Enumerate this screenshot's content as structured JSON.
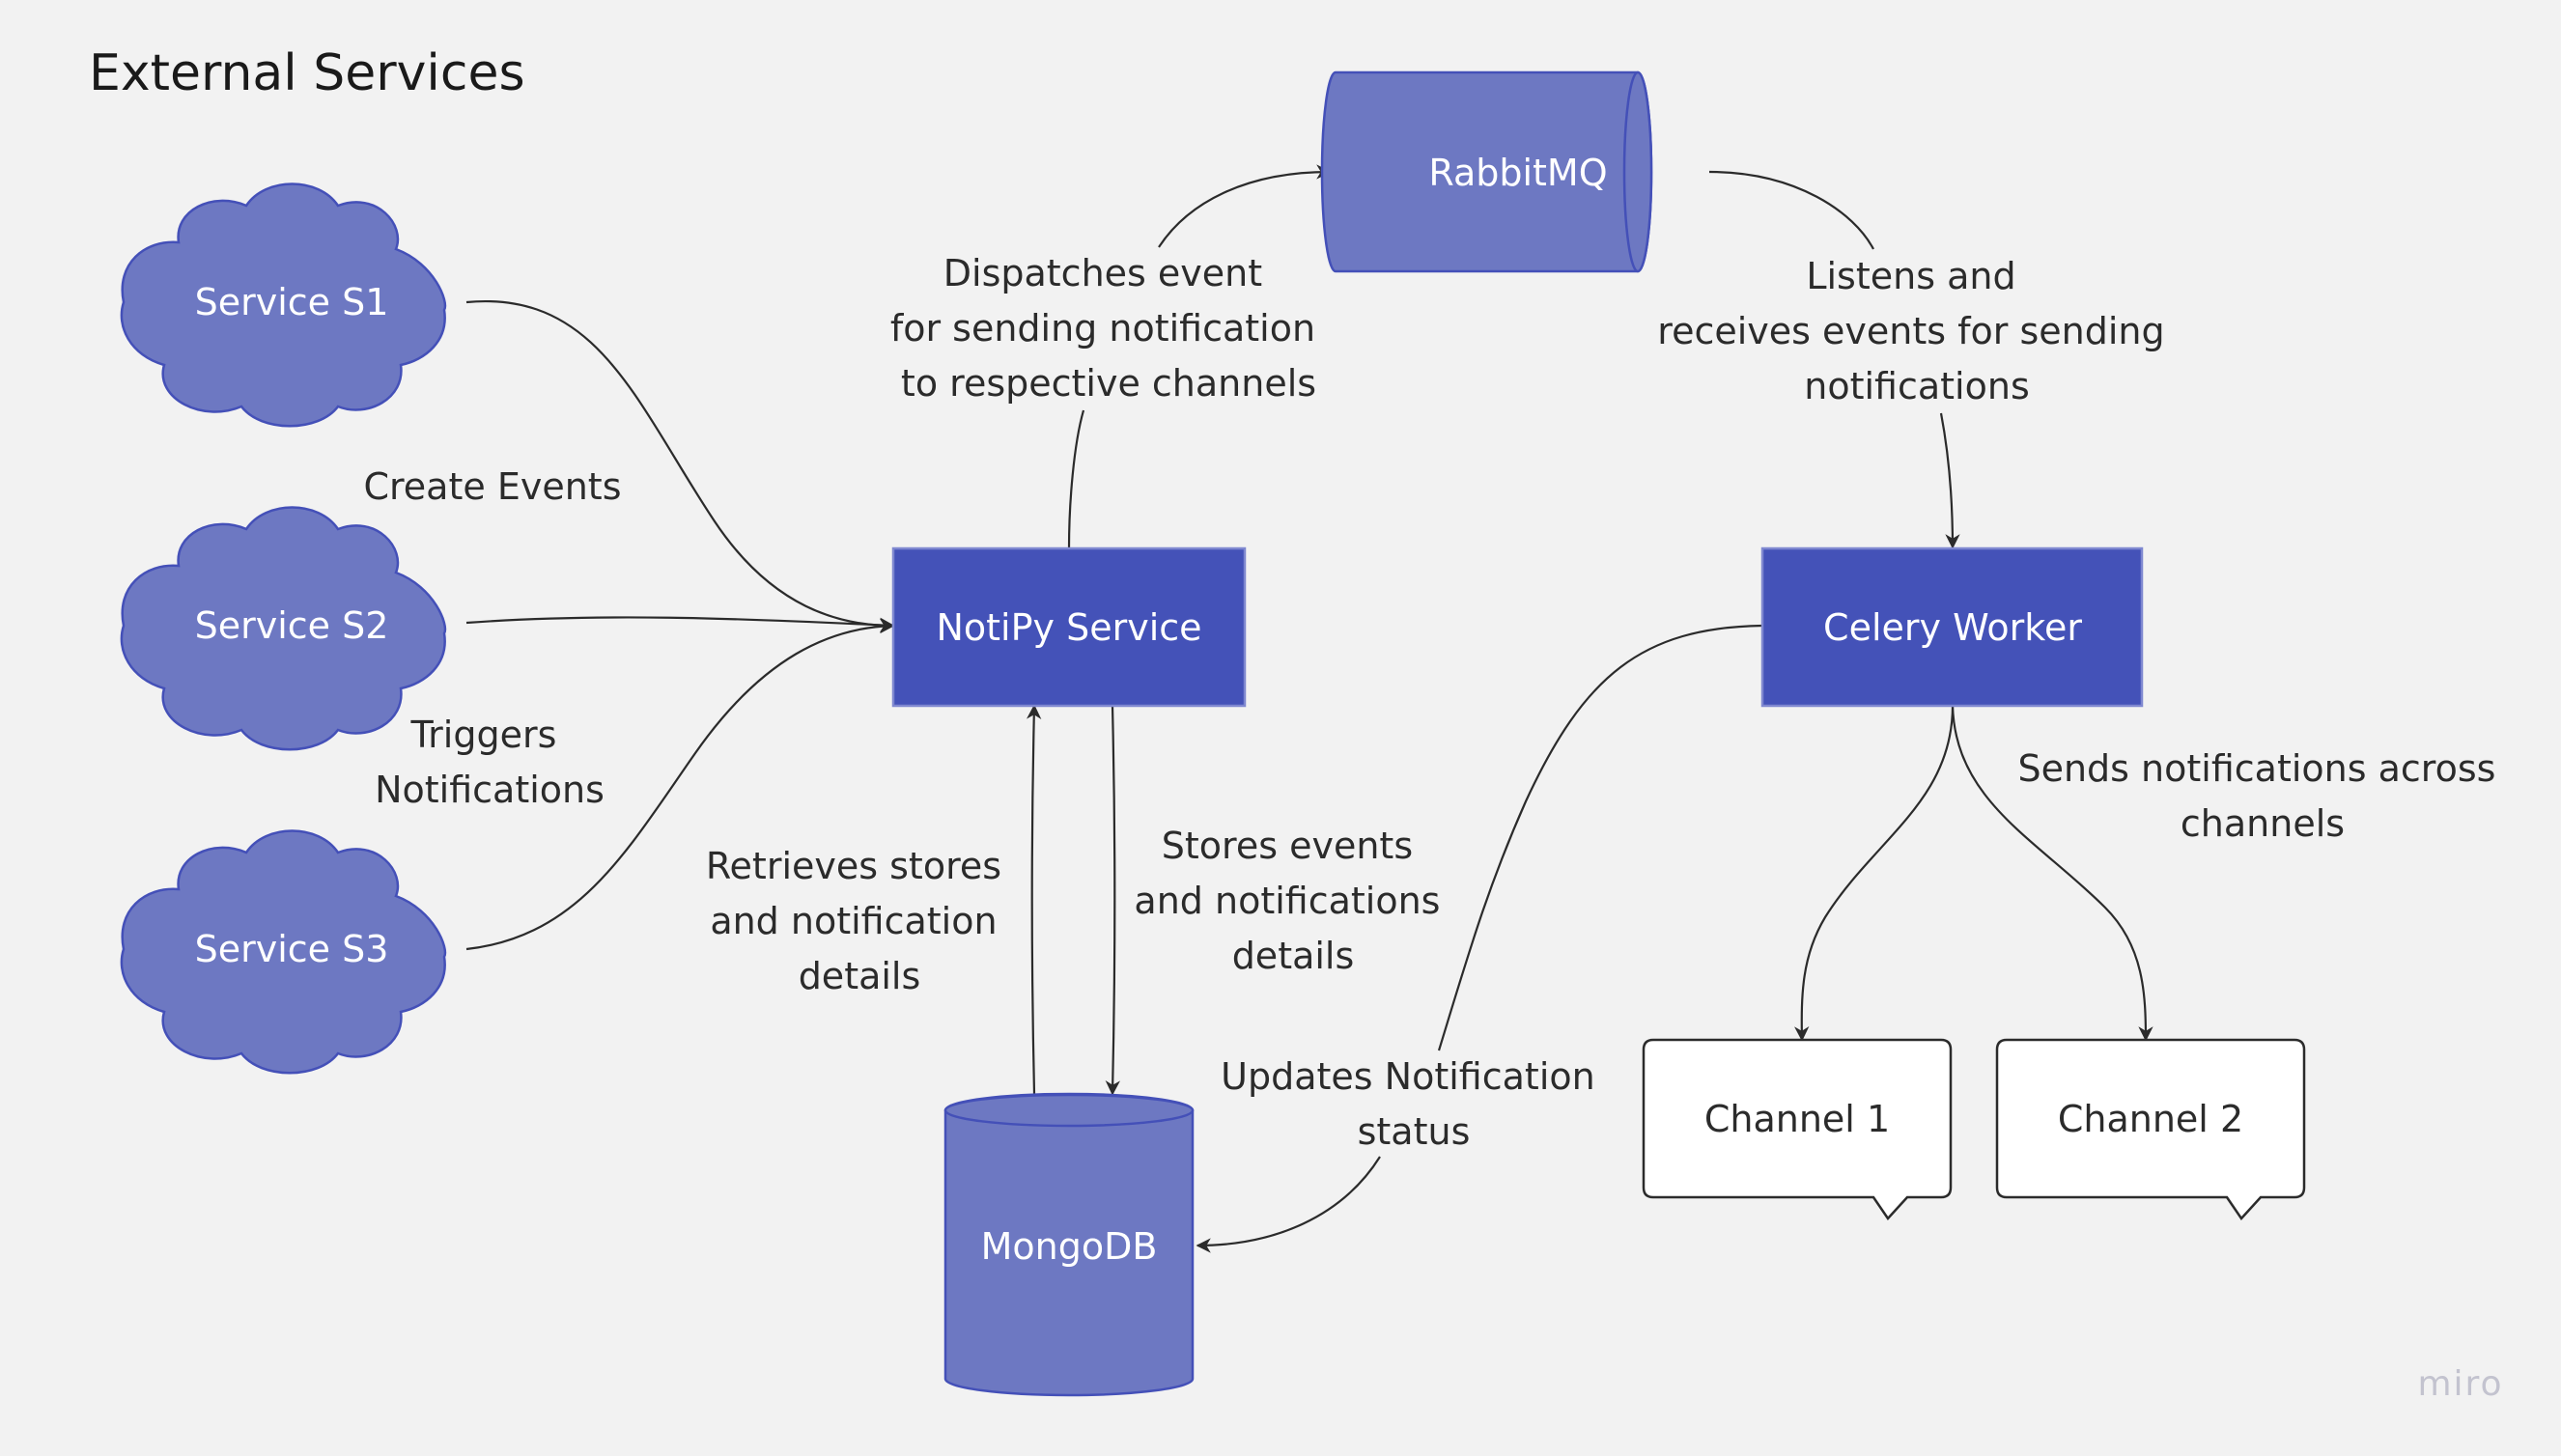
{
  "title": "External Services",
  "colors": {
    "background": "#f2f2f2",
    "cloud_fill": "#6d78c2",
    "cloud_stroke": "#4450b8",
    "box_fill": "#4452b8",
    "box_stroke": "#7f88d0",
    "edge": "#2b2b2b",
    "channel_fill": "#ffffff"
  },
  "nodes": {
    "service_s1": "Service S1",
    "service_s2": "Service S2",
    "service_s3": "Service S3",
    "notipy": "NotiPy Service",
    "rabbitmq": "RabbitMQ",
    "celery": "Celery Worker",
    "mongodb": "MongoDB",
    "channel1": "Channel 1",
    "channel2": "Channel 2"
  },
  "edge_labels": {
    "create_events": [
      "Create Events"
    ],
    "triggers": [
      "Triggers",
      "Notifications"
    ],
    "dispatches": [
      "Dispatches event",
      "for sending notification",
      "to respective channels"
    ],
    "listens": [
      "Listens and",
      "receives events for sending",
      "notifications"
    ],
    "retrieves": [
      "Retrieves stores",
      "and notification",
      "details"
    ],
    "stores": [
      "Stores events",
      "and notifications",
      "details"
    ],
    "updates": [
      "Updates Notification",
      "status"
    ],
    "sends": [
      "Sends notifications across",
      "channels"
    ]
  },
  "brand": "miro"
}
